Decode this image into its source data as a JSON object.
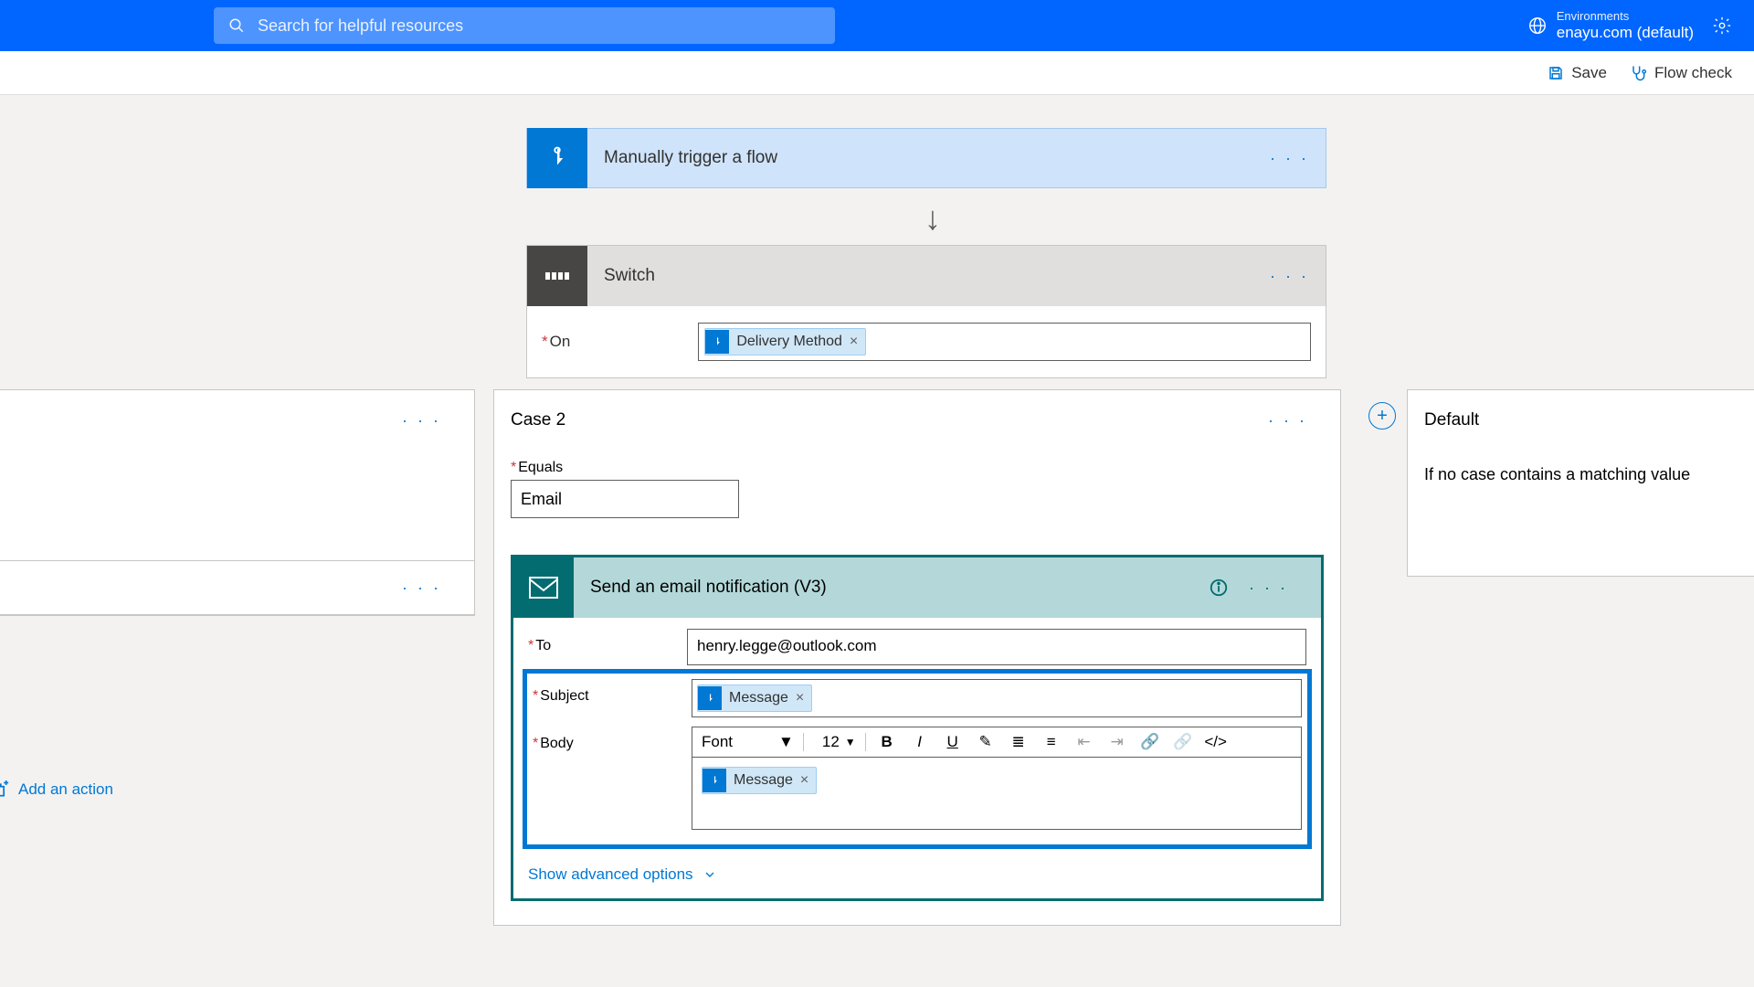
{
  "header": {
    "search_placeholder": "Search for helpful resources",
    "env_label": "Environments",
    "env_name": "enayu.com (default)"
  },
  "toolbar": {
    "save": "Save",
    "flow_check": "Flow check"
  },
  "trigger": {
    "title": "Manually trigger a flow"
  },
  "switch": {
    "title": "Switch",
    "on_label": "On",
    "token": "Delivery Method"
  },
  "case2": {
    "title": "Case 2",
    "equals_label": "Equals",
    "equals_value": "Email"
  },
  "email": {
    "title": "Send an email notification (V3)",
    "to_label": "To",
    "to_value": "henry.legge@outlook.com",
    "subject_label": "Subject",
    "subject_token": "Message",
    "body_label": "Body",
    "body_token": "Message",
    "font_label": "Font",
    "font_size": "12",
    "advanced": "Show advanced options"
  },
  "default_case": {
    "title": "Default",
    "desc": "If no case contains a matching value"
  },
  "add_action": "Add an action"
}
